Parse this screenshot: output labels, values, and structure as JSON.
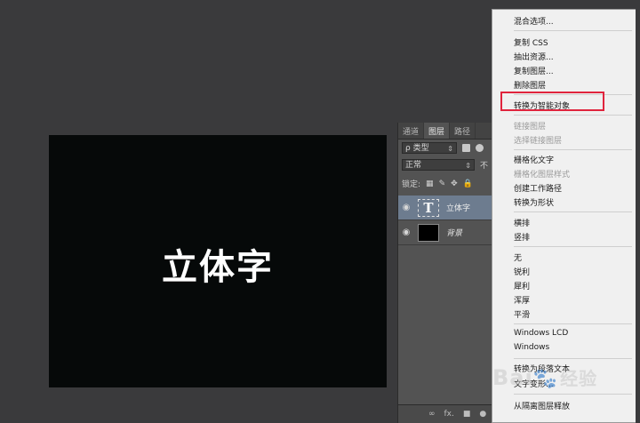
{
  "canvas": {
    "text": "立体字"
  },
  "layers_panel": {
    "tabs": [
      "通道",
      "图层",
      "路径"
    ],
    "active_tab": "图层",
    "filter_label": "ρ 类型",
    "blend_mode": "正常",
    "opacity_label": "不",
    "lock_label": "锁定:",
    "layers": [
      {
        "name": "立体字",
        "type": "text",
        "thumb_glyph": "T",
        "selected": true
      },
      {
        "name": "背景",
        "type": "background",
        "selected": false
      }
    ],
    "bottom_icons": [
      "∞",
      "fx.",
      "■",
      "●"
    ]
  },
  "context_menu": {
    "items": [
      {
        "label": "混合选项...",
        "disabled": false
      },
      {
        "label": "复制 CSS",
        "disabled": false
      },
      {
        "label": "抽出资源...",
        "disabled": false
      },
      {
        "label": "复制图层...",
        "disabled": false
      },
      {
        "label": "删除图层",
        "disabled": false
      },
      {
        "label": "转换为智能对象",
        "disabled": false,
        "highlighted": true
      },
      {
        "label": "链接图层",
        "disabled": true
      },
      {
        "label": "选择链接图层",
        "disabled": true
      },
      {
        "label": "栅格化文字",
        "disabled": false
      },
      {
        "label": "栅格化图层样式",
        "disabled": true
      },
      {
        "label": "创建工作路径",
        "disabled": false
      },
      {
        "label": "转换为形状",
        "disabled": false
      },
      {
        "label": "横排",
        "disabled": false
      },
      {
        "label": "竖排",
        "disabled": false
      },
      {
        "label": "无",
        "disabled": false
      },
      {
        "label": "锐利",
        "disabled": false
      },
      {
        "label": "犀利",
        "disabled": false
      },
      {
        "label": "浑厚",
        "disabled": false
      },
      {
        "label": "平滑",
        "disabled": false
      },
      {
        "label": "Windows LCD",
        "disabled": false
      },
      {
        "label": "Windows",
        "disabled": false
      },
      {
        "label": "转换为段落文本",
        "disabled": false
      },
      {
        "label": "文字变形...",
        "disabled": false
      },
      {
        "label": "从隔离图层释放",
        "disabled": false
      }
    ]
  },
  "watermark": {
    "brand": "Bai",
    "paw": "🐾",
    "suffix": "经验"
  },
  "colors": {
    "highlight_border": "#e0243d",
    "selected_layer": "#6d7c8f"
  }
}
